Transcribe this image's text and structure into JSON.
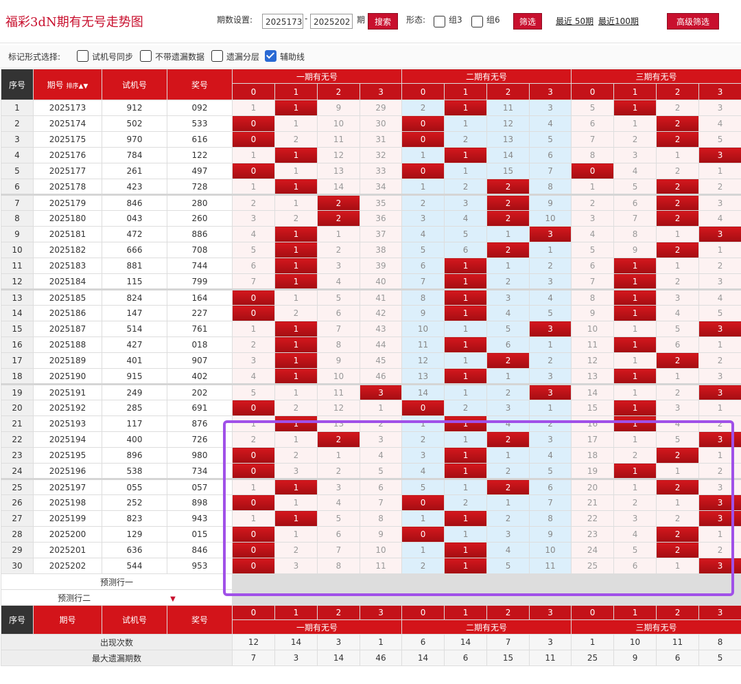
{
  "header": {
    "title": "福彩3dN期有无号走势图",
    "period_label": "期数设置:",
    "period_from": "2025173",
    "period_to": "2025202",
    "period_suffix": "期",
    "search_label": "搜索",
    "form_label": "形态:",
    "group3_label": "组3",
    "group6_label": "组6",
    "filter_label": "筛选",
    "recent50_label": "最近 50期",
    "recent100_label": "最近100期",
    "advanced_label": "高级筛选"
  },
  "options": {
    "label": "标记形式选择:",
    "items": [
      {
        "label": "试机号同步",
        "checked": false
      },
      {
        "label": "不带遗漏数据",
        "checked": false
      },
      {
        "label": "遗漏分层",
        "checked": false
      },
      {
        "label": "辅助线",
        "checked": true
      }
    ]
  },
  "columns": {
    "seq": "序号",
    "issue": "期号",
    "sort_label": "排序",
    "trial": "试机号",
    "prize": "奖号",
    "group1": "一期有无号",
    "group2": "二期有无号",
    "group3": "三期有无号",
    "digits": [
      "0",
      "1",
      "2",
      "3"
    ]
  },
  "rows": [
    {
      "seq": "1",
      "issue": "2025173",
      "trial": "912",
      "prize": "092",
      "g1": [
        "1",
        "1",
        "9",
        "29"
      ],
      "g2": [
        "2",
        "1",
        "11",
        "3"
      ],
      "g3": [
        "5",
        "1",
        "2",
        "3"
      ],
      "h1": 1,
      "h2": 1,
      "h3": 1
    },
    {
      "seq": "2",
      "issue": "2025174",
      "trial": "502",
      "prize": "533",
      "g1": [
        "0",
        "1",
        "10",
        "30"
      ],
      "g2": [
        "0",
        "1",
        "12",
        "4"
      ],
      "g3": [
        "6",
        "1",
        "2",
        "4"
      ],
      "h1": 0,
      "h2": 0,
      "h3": 2
    },
    {
      "seq": "3",
      "issue": "2025175",
      "trial": "970",
      "prize": "616",
      "g1": [
        "0",
        "2",
        "11",
        "31"
      ],
      "g2": [
        "0",
        "2",
        "13",
        "5"
      ],
      "g3": [
        "7",
        "2",
        "2",
        "5"
      ],
      "h1": 0,
      "h2": 0,
      "h3": 2
    },
    {
      "seq": "4",
      "issue": "2025176",
      "trial": "784",
      "prize": "122",
      "g1": [
        "1",
        "1",
        "12",
        "32"
      ],
      "g2": [
        "1",
        "1",
        "14",
        "6"
      ],
      "g3": [
        "8",
        "3",
        "1",
        "3"
      ],
      "h1": 1,
      "h2": 1,
      "h3": 3
    },
    {
      "seq": "5",
      "issue": "2025177",
      "trial": "261",
      "prize": "497",
      "g1": [
        "0",
        "1",
        "13",
        "33"
      ],
      "g2": [
        "0",
        "1",
        "15",
        "7"
      ],
      "g3": [
        "0",
        "4",
        "2",
        "1"
      ],
      "h1": 0,
      "h2": 0,
      "h3": 0
    },
    {
      "seq": "6",
      "issue": "2025178",
      "trial": "423",
      "prize": "728",
      "g1": [
        "1",
        "1",
        "14",
        "34"
      ],
      "g2": [
        "1",
        "2",
        "2",
        "8"
      ],
      "g3": [
        "1",
        "5",
        "2",
        "2"
      ],
      "h1": 1,
      "h2": 2,
      "h3": 2
    },
    {
      "seq": "7",
      "issue": "2025179",
      "trial": "846",
      "prize": "280",
      "g1": [
        "2",
        "1",
        "2",
        "35"
      ],
      "g2": [
        "2",
        "3",
        "2",
        "9"
      ],
      "g3": [
        "2",
        "6",
        "2",
        "3"
      ],
      "h1": 2,
      "h2": 2,
      "h3": 2
    },
    {
      "seq": "8",
      "issue": "2025180",
      "trial": "043",
      "prize": "260",
      "g1": [
        "3",
        "2",
        "2",
        "36"
      ],
      "g2": [
        "3",
        "4",
        "2",
        "10"
      ],
      "g3": [
        "3",
        "7",
        "2",
        "4"
      ],
      "h1": 2,
      "h2": 2,
      "h3": 2
    },
    {
      "seq": "9",
      "issue": "2025181",
      "trial": "472",
      "prize": "886",
      "g1": [
        "4",
        "1",
        "1",
        "37"
      ],
      "g2": [
        "4",
        "5",
        "1",
        "3"
      ],
      "g3": [
        "4",
        "8",
        "1",
        "3"
      ],
      "h1": 1,
      "h2": 3,
      "h3": 3
    },
    {
      "seq": "10",
      "issue": "2025182",
      "trial": "666",
      "prize": "708",
      "g1": [
        "5",
        "1",
        "2",
        "38"
      ],
      "g2": [
        "5",
        "6",
        "2",
        "1"
      ],
      "g3": [
        "5",
        "9",
        "2",
        "1"
      ],
      "h1": 1,
      "h2": 2,
      "h3": 2
    },
    {
      "seq": "11",
      "issue": "2025183",
      "trial": "881",
      "prize": "744",
      "g1": [
        "6",
        "1",
        "3",
        "39"
      ],
      "g2": [
        "6",
        "1",
        "1",
        "2"
      ],
      "g3": [
        "6",
        "1",
        "1",
        "2"
      ],
      "h1": 1,
      "h2": 1,
      "h3": 1
    },
    {
      "seq": "12",
      "issue": "2025184",
      "trial": "115",
      "prize": "799",
      "g1": [
        "7",
        "1",
        "4",
        "40"
      ],
      "g2": [
        "7",
        "1",
        "2",
        "3"
      ],
      "g3": [
        "7",
        "1",
        "2",
        "3"
      ],
      "h1": 1,
      "h2": 1,
      "h3": 1
    },
    {
      "seq": "13",
      "issue": "2025185",
      "trial": "824",
      "prize": "164",
      "g1": [
        "0",
        "1",
        "5",
        "41"
      ],
      "g2": [
        "8",
        "1",
        "3",
        "4"
      ],
      "g3": [
        "8",
        "1",
        "3",
        "4"
      ],
      "h1": 0,
      "h2": 1,
      "h3": 1
    },
    {
      "seq": "14",
      "issue": "2025186",
      "trial": "147",
      "prize": "227",
      "g1": [
        "0",
        "2",
        "6",
        "42"
      ],
      "g2": [
        "9",
        "1",
        "4",
        "5"
      ],
      "g3": [
        "9",
        "1",
        "4",
        "5"
      ],
      "h1": 0,
      "h2": 1,
      "h3": 1
    },
    {
      "seq": "15",
      "issue": "2025187",
      "trial": "514",
      "prize": "761",
      "g1": [
        "1",
        "1",
        "7",
        "43"
      ],
      "g2": [
        "10",
        "1",
        "5",
        "3"
      ],
      "g3": [
        "10",
        "1",
        "5",
        "3"
      ],
      "h1": 1,
      "h2": 3,
      "h3": 3
    },
    {
      "seq": "16",
      "issue": "2025188",
      "trial": "427",
      "prize": "018",
      "g1": [
        "2",
        "1",
        "8",
        "44"
      ],
      "g2": [
        "11",
        "1",
        "6",
        "1"
      ],
      "g3": [
        "11",
        "1",
        "6",
        "1"
      ],
      "h1": 1,
      "h2": 1,
      "h3": 1
    },
    {
      "seq": "17",
      "issue": "2025189",
      "trial": "401",
      "prize": "907",
      "g1": [
        "3",
        "1",
        "9",
        "45"
      ],
      "g2": [
        "12",
        "1",
        "2",
        "2"
      ],
      "g3": [
        "12",
        "1",
        "2",
        "2"
      ],
      "h1": 1,
      "h2": 2,
      "h3": 2
    },
    {
      "seq": "18",
      "issue": "2025190",
      "trial": "915",
      "prize": "402",
      "g1": [
        "4",
        "1",
        "10",
        "46"
      ],
      "g2": [
        "13",
        "1",
        "1",
        "3"
      ],
      "g3": [
        "13",
        "1",
        "1",
        "3"
      ],
      "h1": 1,
      "h2": 1,
      "h3": 1
    },
    {
      "seq": "19",
      "issue": "2025191",
      "trial": "249",
      "prize": "202",
      "g1": [
        "5",
        "1",
        "11",
        "3"
      ],
      "g2": [
        "14",
        "1",
        "2",
        "3"
      ],
      "g3": [
        "14",
        "1",
        "2",
        "3"
      ],
      "h1": 3,
      "h2": 3,
      "h3": 3
    },
    {
      "seq": "20",
      "issue": "2025192",
      "trial": "285",
      "prize": "691",
      "g1": [
        "0",
        "2",
        "12",
        "1"
      ],
      "g2": [
        "0",
        "2",
        "3",
        "1"
      ],
      "g3": [
        "15",
        "1",
        "3",
        "1"
      ],
      "h1": 0,
      "h2": 0,
      "h3": 1
    },
    {
      "seq": "21",
      "issue": "2025193",
      "trial": "117",
      "prize": "876",
      "g1": [
        "1",
        "1",
        "13",
        "2"
      ],
      "g2": [
        "1",
        "1",
        "4",
        "2"
      ],
      "g3": [
        "16",
        "1",
        "4",
        "2"
      ],
      "h1": 1,
      "h2": 1,
      "h3": 1
    },
    {
      "seq": "22",
      "issue": "2025194",
      "trial": "400",
      "prize": "726",
      "g1": [
        "2",
        "1",
        "2",
        "3"
      ],
      "g2": [
        "2",
        "1",
        "2",
        "3"
      ],
      "g3": [
        "17",
        "1",
        "5",
        "3"
      ],
      "h1": 2,
      "h2": 2,
      "h3": 3
    },
    {
      "seq": "23",
      "issue": "2025195",
      "trial": "896",
      "prize": "980",
      "g1": [
        "0",
        "2",
        "1",
        "4"
      ],
      "g2": [
        "3",
        "1",
        "1",
        "4"
      ],
      "g3": [
        "18",
        "2",
        "2",
        "1"
      ],
      "h1": 0,
      "h2": 1,
      "h3": 2
    },
    {
      "seq": "24",
      "issue": "2025196",
      "trial": "538",
      "prize": "734",
      "g1": [
        "0",
        "3",
        "2",
        "5"
      ],
      "g2": [
        "4",
        "1",
        "2",
        "5"
      ],
      "g3": [
        "19",
        "1",
        "1",
        "2"
      ],
      "h1": 0,
      "h2": 1,
      "h3": 1
    },
    {
      "seq": "25",
      "issue": "2025197",
      "trial": "055",
      "prize": "057",
      "g1": [
        "1",
        "1",
        "3",
        "6"
      ],
      "g2": [
        "5",
        "1",
        "2",
        "6"
      ],
      "g3": [
        "20",
        "1",
        "2",
        "3"
      ],
      "h1": 1,
      "h2": 2,
      "h3": 2
    },
    {
      "seq": "26",
      "issue": "2025198",
      "trial": "252",
      "prize": "898",
      "g1": [
        "0",
        "1",
        "4",
        "7"
      ],
      "g2": [
        "0",
        "2",
        "1",
        "7"
      ],
      "g3": [
        "21",
        "2",
        "1",
        "3"
      ],
      "h1": 0,
      "h2": 0,
      "h3": 3
    },
    {
      "seq": "27",
      "issue": "2025199",
      "trial": "823",
      "prize": "943",
      "g1": [
        "1",
        "1",
        "5",
        "8"
      ],
      "g2": [
        "1",
        "1",
        "2",
        "8"
      ],
      "g3": [
        "22",
        "3",
        "2",
        "3"
      ],
      "h1": 1,
      "h2": 1,
      "h3": 3
    },
    {
      "seq": "28",
      "issue": "2025200",
      "trial": "129",
      "prize": "015",
      "g1": [
        "0",
        "1",
        "6",
        "9"
      ],
      "g2": [
        "0",
        "1",
        "3",
        "9"
      ],
      "g3": [
        "23",
        "4",
        "2",
        "1"
      ],
      "h1": 0,
      "h2": 0,
      "h3": 2
    },
    {
      "seq": "29",
      "issue": "2025201",
      "trial": "636",
      "prize": "846",
      "g1": [
        "0",
        "2",
        "7",
        "10"
      ],
      "g2": [
        "1",
        "1",
        "4",
        "10"
      ],
      "g3": [
        "24",
        "5",
        "2",
        "2"
      ],
      "h1": 0,
      "h2": 1,
      "h3": 2
    },
    {
      "seq": "30",
      "issue": "2025202",
      "trial": "544",
      "prize": "953",
      "g1": [
        "0",
        "3",
        "8",
        "11"
      ],
      "g2": [
        "2",
        "1",
        "5",
        "11"
      ],
      "g3": [
        "25",
        "6",
        "1",
        "3"
      ],
      "h1": 0,
      "h2": 1,
      "h3": 3
    }
  ],
  "predict": {
    "row1": "预测行一",
    "row2": "预测行二"
  },
  "stats": [
    {
      "label": "出现次数",
      "values": [
        "12",
        "14",
        "3",
        "1",
        "6",
        "14",
        "7",
        "3",
        "1",
        "10",
        "11",
        "8"
      ]
    },
    {
      "label": "最大遗漏期数",
      "values": [
        "7",
        "3",
        "14",
        "46",
        "14",
        "6",
        "15",
        "11",
        "25",
        "9",
        "6",
        "5"
      ]
    }
  ],
  "colors": {
    "accent_red": "#d3141a",
    "hit_red": "#c1121a",
    "blue_band": "#dceffb",
    "selection": "#a050e8"
  }
}
